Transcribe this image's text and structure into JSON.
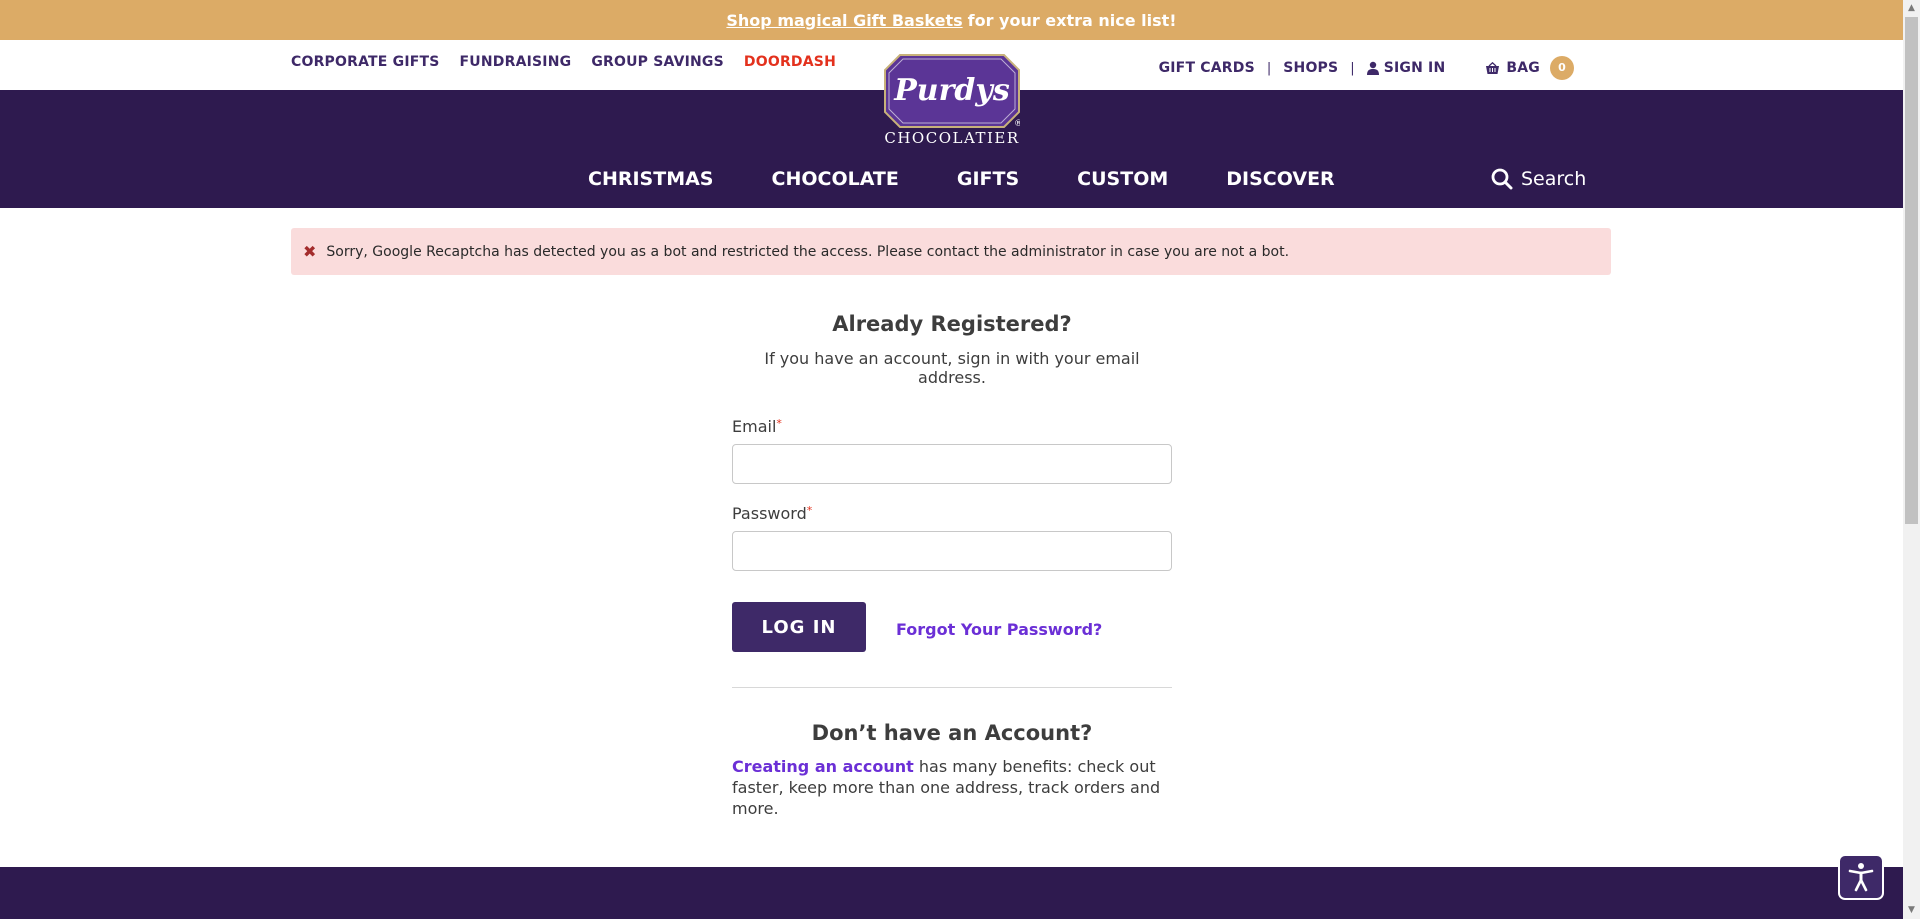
{
  "promo": {
    "link_text": "Shop magical Gift Baskets",
    "rest_text": "for your extra nice list!"
  },
  "utility": {
    "left_links": [
      "CORPORATE GIFTS",
      "FUNDRAISING",
      "GROUP SAVINGS",
      "DOORDASH"
    ],
    "gift_cards": "GIFT CARDS",
    "shops": "SHOPS",
    "sign_in": "SIGN IN",
    "bag_label": "BAG",
    "bag_count": "0"
  },
  "logo": {
    "brand": "Purdys",
    "wordmark": "CHOCOLATIER"
  },
  "nav": {
    "items": [
      "CHRISTMAS",
      "CHOCOLATE",
      "GIFTS",
      "CUSTOM",
      "DISCOVER"
    ],
    "search_label": "Search"
  },
  "alert": {
    "message": "Sorry, Google Recaptcha has detected you as a bot and restricted the access. Please contact the administrator in case you are not a bot."
  },
  "login": {
    "title": "Already Registered?",
    "subtitle": "If you have an account, sign in with your email address.",
    "email_label": "Email",
    "email_value": "",
    "password_label": "Password",
    "password_value": "",
    "required_mark": "*",
    "submit_label": "LOG IN",
    "forgot_label": "Forgot Your Password?"
  },
  "register": {
    "title": "Don’t have an Account?",
    "link_text": "Creating an account",
    "rest_text": "has many benefits: check out faster, keep more than one address, track orders and more."
  },
  "colors": {
    "brand_purple": "#2e1a4f",
    "button_purple": "#3e2968",
    "gold": "#dcab66",
    "alert_bg": "#fadcdc",
    "link_purple": "#6b2fd6",
    "doordash_red": "#e3311d"
  },
  "icons": {
    "signin": "user-icon",
    "bag": "basket-icon",
    "search": "search-icon",
    "alert": "close-icon",
    "accessibility": "accessibility-icon"
  }
}
